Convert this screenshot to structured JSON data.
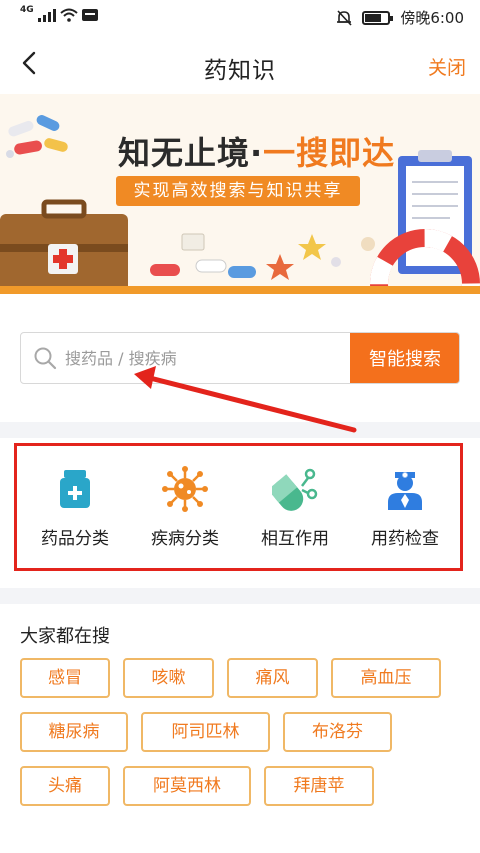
{
  "status_bar": {
    "network": "4G",
    "time": "傍晚6:00"
  },
  "nav": {
    "title": "药知识",
    "close_label": "关闭"
  },
  "banner": {
    "headline_part1": "知无止境·",
    "headline_part2": "一搜即达",
    "tagline": "实现高效搜索与知识共享"
  },
  "search": {
    "placeholder": "搜药品 / 搜疾病",
    "button_label": "智能搜索"
  },
  "categories": [
    {
      "label": "药品分类",
      "icon": "medicine-bottle-icon"
    },
    {
      "label": "疾病分类",
      "icon": "virus-icon"
    },
    {
      "label": "相互作用",
      "icon": "capsule-interaction-icon"
    },
    {
      "label": "用药检查",
      "icon": "doctor-icon"
    }
  ],
  "hot_searches": {
    "heading": "大家都在搜",
    "items": [
      "感冒",
      "咳嗽",
      "痛风",
      "高血压",
      "糖尿病",
      "阿司匹林",
      "布洛芬",
      "头痛",
      "阿莫西林",
      "拜唐苹"
    ]
  },
  "colors": {
    "accent": "#f4701c",
    "chip_border": "#f0b866",
    "highlight": "#e3241c",
    "icon_teal": "#2aa6c9",
    "icon_orange": "#f08a24",
    "icon_green": "#49b88e",
    "icon_blue": "#2f7de0"
  }
}
